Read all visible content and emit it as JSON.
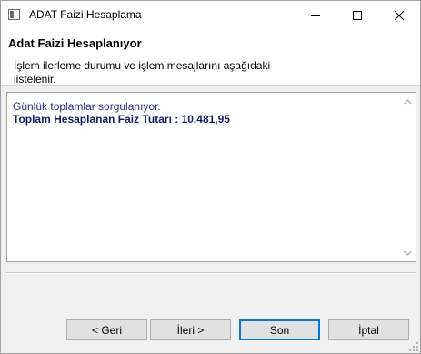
{
  "window": {
    "title": "ADAT Faizi Hesaplama",
    "controls": {
      "minimize": "minimize-icon",
      "maximize": "maximize-icon",
      "close": "close-icon"
    }
  },
  "header": {
    "title": "Adat Faizi Hesaplanıyor",
    "description": "İşlem ilerleme durumu ve işlem mesajlarını aşağıdaki listelenir."
  },
  "log": {
    "lines": [
      "Günlük toplamlar sorgulanıyor.",
      "Toplam Hesaplanan Faiz Tutarı : 10.481,95"
    ]
  },
  "buttons": {
    "back": "< Geri",
    "next": "İleri >",
    "finish": "Son",
    "cancel": "İptal"
  },
  "colors": {
    "log_text": "#2a2a7a",
    "default_button_border": "#0078d7"
  }
}
